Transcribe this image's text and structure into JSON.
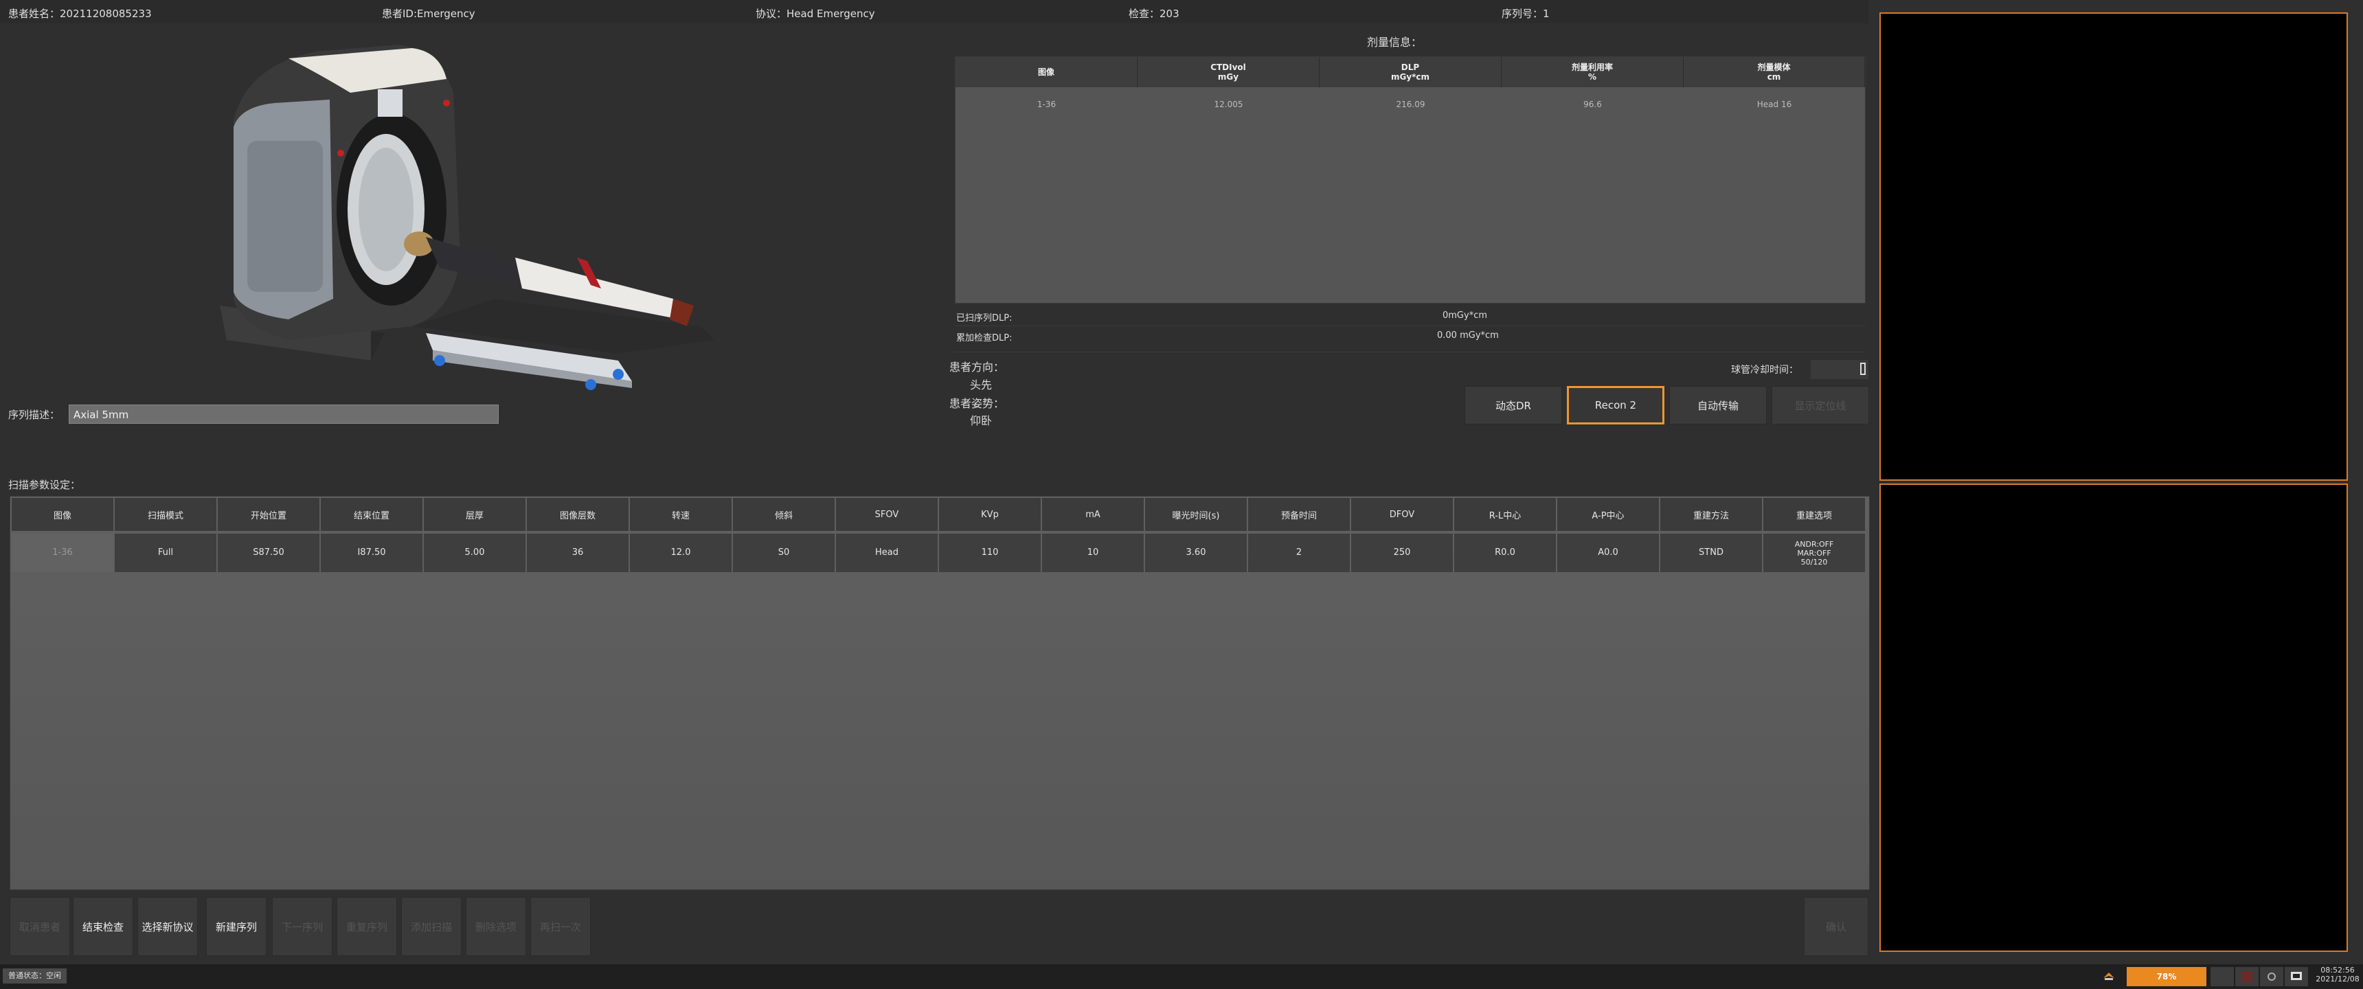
{
  "header": {
    "patient_name": "患者姓名：20211208085233",
    "patient_id": "患者ID:Emergency",
    "protocol": "协议：Head Emergency",
    "exam": "检查：203",
    "series_no": "序列号：1"
  },
  "dose": {
    "title": "剂量信息：",
    "columns": [
      {
        "l1": "图像",
        "l2": ""
      },
      {
        "l1": "CTDIvol",
        "l2": "mGy"
      },
      {
        "l1": "DLP",
        "l2": "mGy*cm"
      },
      {
        "l1": "剂量利用率",
        "l2": "%"
      },
      {
        "l1": "剂量模体",
        "l2": "cm"
      }
    ],
    "row": [
      "1-36",
      "12.005",
      "216.09",
      "96.6",
      "Head 16"
    ],
    "scanned_dlp_label": "已扫序列DLP:",
    "scanned_dlp_value": "0mGy*cm",
    "total_dlp_label": "累加检查DLP:",
    "total_dlp_value": "0.00 mGy*cm"
  },
  "patient": {
    "direction_label": "患者方向：",
    "direction_value": "头先",
    "position_label": "患者姿势：",
    "position_value": "仰卧"
  },
  "actions": {
    "dynamic_dr": "动态DR",
    "recon2": "Recon 2",
    "auto_transfer": "自动传输",
    "show_locator": "显示定位线"
  },
  "tube_cool_label": "球管冷却时间：",
  "sequence": {
    "label": "序列描述：",
    "value": "Axial 5mm"
  },
  "scan_params": {
    "label": "扫描参数设定：",
    "columns": [
      "图像",
      "扫描模式",
      "开始位置",
      "结束位置",
      "层厚",
      "图像层数",
      "转速",
      "倾斜",
      "SFOV",
      "KVp",
      "mA",
      "曝光时间(s)",
      "预备时间",
      "DFOV",
      "R-L中心",
      "A-P中心",
      "重建方法",
      "重建选项"
    ],
    "row": [
      "1-36",
      "Full",
      "S87.50",
      "I87.50",
      "5.00",
      "36",
      "12.0",
      "S0",
      "Head",
      "110",
      "10",
      "3.60",
      "2",
      "250",
      "R0.0",
      "A0.0",
      "STND",
      "ANDR:OFF\nMAR:OFF\n50/120"
    ]
  },
  "bottom_buttons": [
    {
      "label": "取消患者",
      "enabled": false
    },
    {
      "label": "结束检查",
      "enabled": true
    },
    {
      "label": "选择新协议",
      "enabled": true
    },
    {
      "label": "新建序列",
      "enabled": true
    },
    {
      "label": "下一序列",
      "enabled": false
    },
    {
      "label": "重复序列",
      "enabled": false
    },
    {
      "label": "添加扫描",
      "enabled": false
    },
    {
      "label": "删除选项",
      "enabled": false
    },
    {
      "label": "再扫一次",
      "enabled": false
    }
  ],
  "confirm_button": "确认",
  "status": {
    "text": "普通状态：空闲",
    "progress": "78%",
    "progress_value": 0.78,
    "time": "08:52:56",
    "date": "2021/12/08"
  },
  "colors": {
    "accent": "#f0962d",
    "background": "#2f2f2f",
    "viewport_border": "#d97a2a"
  }
}
